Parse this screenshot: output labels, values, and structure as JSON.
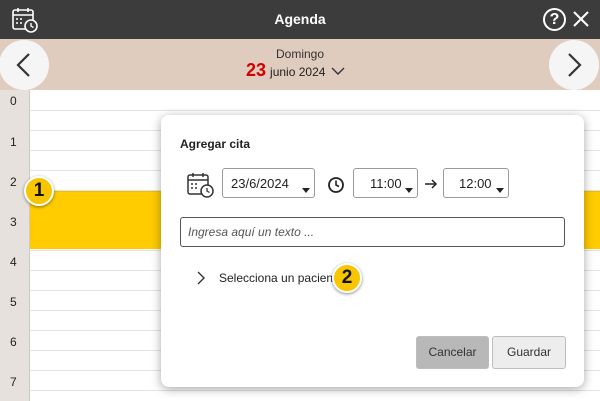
{
  "app": {
    "title": "Agenda",
    "help_label": "?"
  },
  "date_header": {
    "weekday": "Domingo",
    "day": "23",
    "month_year": "junio 2024"
  },
  "hours": [
    "0",
    "1",
    "2",
    "3",
    "4",
    "5",
    "6",
    "7"
  ],
  "dialog": {
    "title": "Agregar cita",
    "date_value": "23/6/2024",
    "start_time": "11:00",
    "end_time": "12:00",
    "text_placeholder": "Ingresa aquí un texto ...",
    "patient_label": "Selecciona un paciente",
    "cancel_label": "Cancelar",
    "save_label": "Guardar"
  },
  "badges": {
    "first": "1",
    "second": "2"
  },
  "colors": {
    "titlebar": "#3c3c3c",
    "date_header": "#e0cbbf",
    "day_number": "#d40000",
    "appointment": "#ffcc00",
    "badge": "#f7c600"
  },
  "icons": {
    "app": "calendar-clock-icon",
    "help": "help-icon",
    "close": "close-icon",
    "prev": "chevron-left-icon",
    "next": "chevron-right-icon",
    "date_dropdown": "chevron-down-icon",
    "date_picker": "calendar-clock-icon",
    "time": "clock-icon",
    "range": "arrow-right-icon",
    "expand_patient": "chevron-right-icon"
  }
}
